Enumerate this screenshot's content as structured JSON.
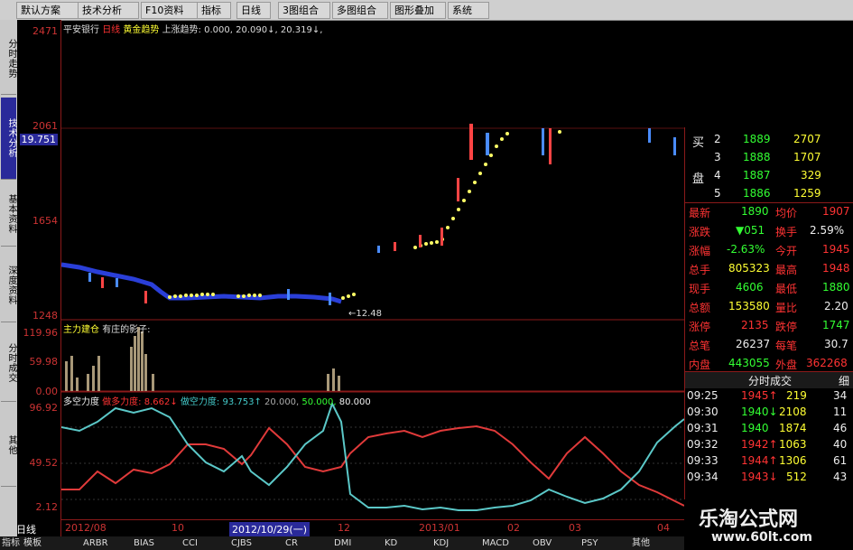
{
  "toolbar": {
    "items": [
      "默认方案",
      "技术分析",
      "F10资料",
      "指标",
      "日线",
      "3图组合",
      "多图组合",
      "图形叠加",
      "系统"
    ]
  },
  "sidebar": {
    "tabs": [
      "分时走势",
      "技术分析",
      "基本资料",
      "深度资料",
      "分时成交",
      "其他"
    ]
  },
  "price_axis": {
    "ticks": [
      "2471",
      "2061",
      "19.751",
      "1654",
      "1248"
    ]
  },
  "volume_axis": {
    "ticks": [
      "119.96",
      "59.98",
      "0.00"
    ]
  },
  "osc_axis": {
    "ticks": [
      "96.92",
      "49.52",
      "2.12"
    ]
  },
  "main_header": {
    "stock": "平安银行",
    "period": "日线",
    "ind1": "黄金趋势",
    "ind2": "上涨趋势: 0.000,",
    "val1": "20.090↓",
    "val2": "20.319↓,"
  },
  "low_marker": "12.48",
  "vol_header": {
    "title": "主力建仓",
    "sub": "有庄的影子:"
  },
  "osc_header": {
    "title": "多空力度",
    "short_label": "做多力度: 8.662↓",
    "long_label": "做空力度: 93.753↑",
    "l1": "20.000,",
    "l2": "50.000,",
    "l3": "80.000"
  },
  "xaxis": {
    "period_label": "日线",
    "ticks": [
      "2012/08",
      "10",
      "2012/10/29(一)",
      "12",
      "2013/01",
      "02",
      "03",
      "04"
    ]
  },
  "bottom_tabs": [
    "指标",
    "模板",
    "ARBR",
    "BIAS",
    "CCI",
    "CJBS",
    "CR",
    "DMI",
    "KD",
    "KDJ",
    "MACD",
    "OBV",
    "PSY",
    "其他"
  ],
  "order_book": [
    {
      "side": "买",
      "level": "2",
      "price": "1889",
      "vol": "2707"
    },
    {
      "side": "",
      "level": "3",
      "price": "1888",
      "vol": "1707"
    },
    {
      "side": "盘",
      "level": "4",
      "price": "1887",
      "vol": "329"
    },
    {
      "side": "",
      "level": "5",
      "price": "1886",
      "vol": "1259"
    }
  ],
  "quote": [
    {
      "l": "最新",
      "v": "1890",
      "l2": "均价",
      "v2": "1907"
    },
    {
      "l": "涨跌",
      "v": "▼051",
      "l2": "换手",
      "v2": "2.59%"
    },
    {
      "l": "涨幅",
      "v": "-2.63%",
      "l2": "今开",
      "v2": "1945"
    },
    {
      "l": "总手",
      "v": "805323",
      "l2": "最高",
      "v2": "1948"
    },
    {
      "l": "现手",
      "v": "4606",
      "l2": "最低",
      "v2": "1880"
    },
    {
      "l": "总额",
      "v": "153580",
      "l2": "量比",
      "v2": "2.20"
    },
    {
      "l": "涨停",
      "v": "2135",
      "l2": "跌停",
      "v2": "1747"
    },
    {
      "l": "总笔",
      "v": "26237",
      "l2": "每笔",
      "v2": "30.7"
    },
    {
      "l": "内盘",
      "v": "443055",
      "l2": "外盘",
      "v2": "362268"
    }
  ],
  "ticks_header": {
    "title": "分时成交",
    "more": "细"
  },
  "trades": [
    {
      "t": "09:25",
      "p": "1945",
      "dir": "↑",
      "v": "219",
      "n": "34"
    },
    {
      "t": "09:30",
      "p": "1940",
      "dir": "↓",
      "v": "2108",
      "n": "11"
    },
    {
      "t": "09:31",
      "p": "1940",
      "dir": "",
      "v": "1874",
      "n": "46"
    },
    {
      "t": "09:32",
      "p": "1942",
      "dir": "↑",
      "v": "1063",
      "n": "40"
    },
    {
      "t": "09:33",
      "p": "1944",
      "dir": "↑",
      "v": "1306",
      "n": "61"
    },
    {
      "t": "09:34",
      "p": "1943",
      "dir": "↓",
      "v": "512",
      "n": "43"
    }
  ],
  "watermark": {
    "title": "乐淘公式网",
    "url": "www.60lt.com"
  },
  "colors": {
    "up": "#ff3333",
    "down": "#33ff33",
    "axis": "#8b1a1a",
    "sar": "#ffff66",
    "line_red": "#e03a3a",
    "line_cyan": "#5bc8c8"
  }
}
